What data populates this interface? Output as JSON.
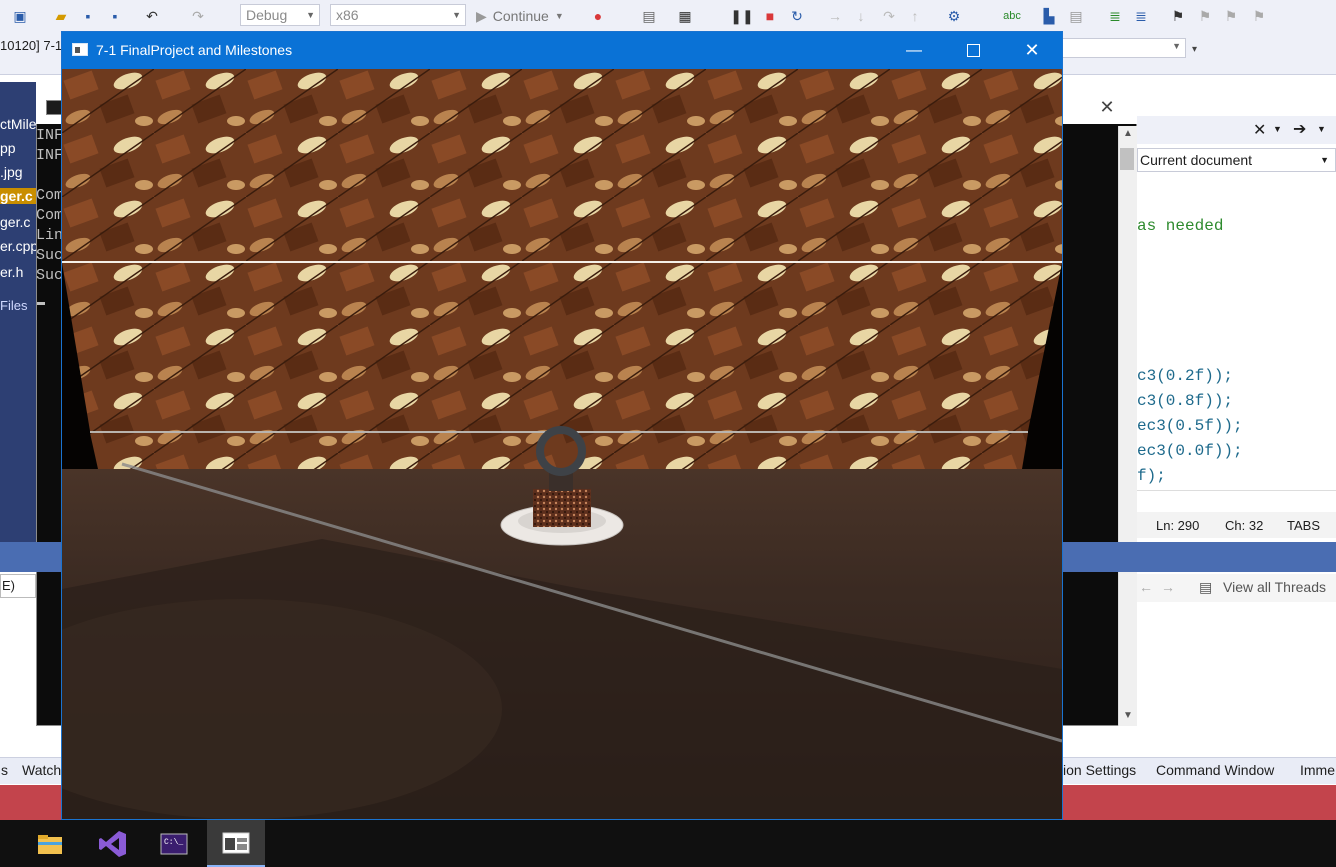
{
  "vs": {
    "config_combo": "Debug",
    "platform_combo": "x86",
    "continue_label": "Continue",
    "tab_fragment": "10120] 7-1"
  },
  "solution_items": [
    "ctMile",
    "pp",
    ".jpg",
    "ger.c",
    "ger.c",
    "er.cpp",
    "er.h",
    "Files"
  ],
  "console": {
    "lines": [
      "INF",
      "INF",
      "",
      "Com",
      "Com",
      "Lin",
      "Suc",
      "Suc"
    ]
  },
  "editor": {
    "find_scope": "Current document",
    "code_lines": [
      {
        "text": "as needed",
        "kind": "comment"
      },
      {
        "text": "c3(0.2f));",
        "kind": "code"
      },
      {
        "text": "c3(0.8f));",
        "kind": "code"
      },
      {
        "text": "ec3(0.5f));",
        "kind": "code"
      },
      {
        "text": "ec3(0.0f));",
        "kind": "code"
      },
      {
        "text": "f);",
        "kind": "code"
      }
    ],
    "status": {
      "line": "Ln: 290",
      "col": "Ch: 32",
      "mode": "TABS"
    }
  },
  "threads": {
    "label": "View all Threads"
  },
  "left_field": "E)",
  "bottom_tabs": {
    "left": [
      "s",
      "Watch"
    ],
    "right": [
      "ion Settings",
      "Command Window",
      "Imme"
    ]
  },
  "app_window": {
    "title": "7-1 FinalProject and Milestones"
  },
  "colors": {
    "vs_blue": "#0a72d6",
    "vs_status": "#c3444c",
    "solution_bg": "#2d3f73",
    "band_blue": "#4a6db2"
  },
  "taskbar_icons": [
    "file-explorer-icon",
    "visual-studio-icon",
    "console-icon",
    "opengl-app-icon"
  ]
}
